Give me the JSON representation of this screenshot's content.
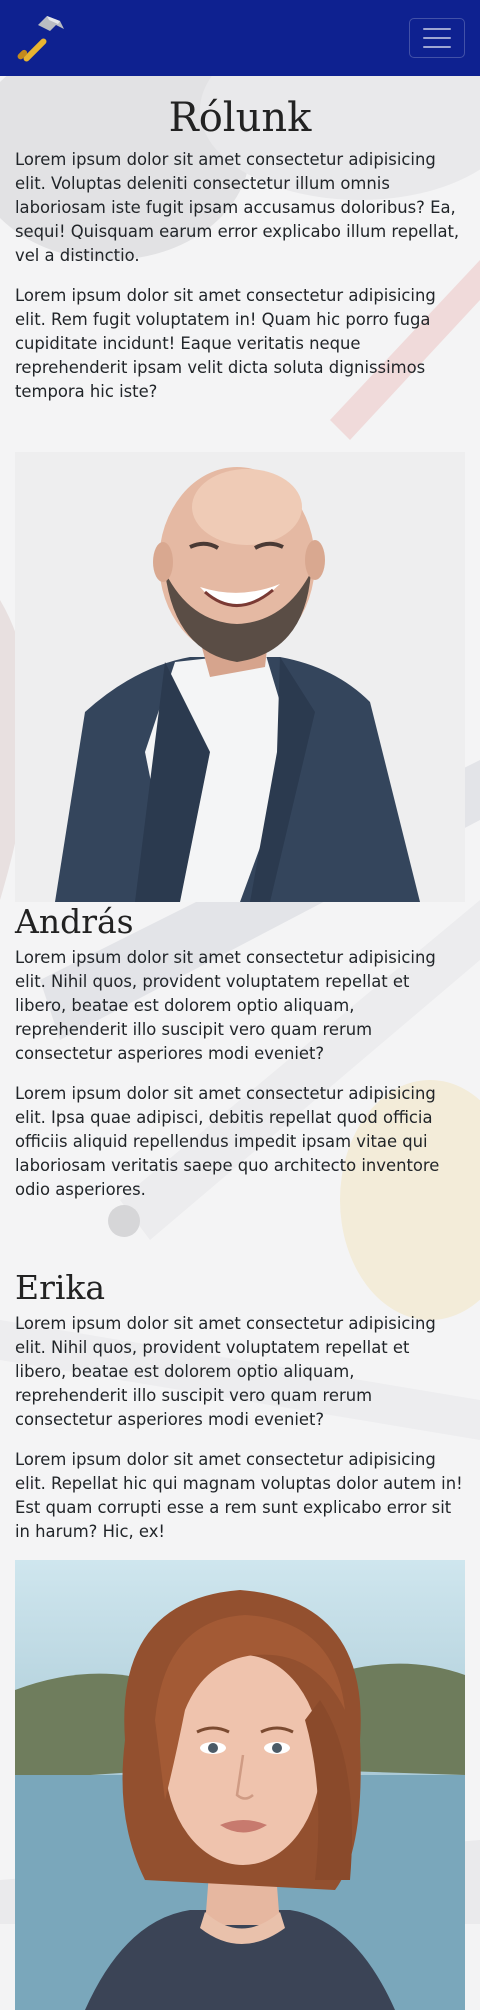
{
  "navbar": {
    "logo_icon": "hammer-icon",
    "toggle_icon": "hamburger-menu-icon",
    "color": "#0e2190"
  },
  "about": {
    "title": "Rólunk",
    "paragraphs": [
      "Lorem ipsum dolor sit amet consectetur adipisicing elit. Voluptas deleniti consectetur illum omnis laboriosam iste fugit ipsam accusamus doloribus? Ea, sequi! Quisquam earum error explicabo illum repellat, vel a distinctio.",
      "Lorem ipsum dolor sit amet consectetur adipisicing elit. Rem fugit voluptatem in! Quam hic porro fuga cupiditate incidunt! Eaque veritatis neque reprehenderit ipsam velit dicta soluta dignissimos tempora hic iste?"
    ]
  },
  "people": [
    {
      "name": "András",
      "photo": "portrait-laughing-bald-man",
      "paragraphs": [
        "Lorem ipsum dolor sit amet consectetur adipisicing elit. Nihil quos, provident voluptatem repellat et libero, beatae est dolorem optio aliquam, reprehenderit illo suscipit vero quam rerum consectetur asperiores modi eveniet?",
        "Lorem ipsum dolor sit amet consectetur adipisicing elit. Ipsa quae adipisci, debitis repellat quod officia officiis aliquid repellendus impedit ipsam vitae qui laboriosam veritatis saepe quo architecto inventore odio asperiores."
      ]
    },
    {
      "name": "Erika",
      "photo": "portrait-red-haired-woman",
      "paragraphs": [
        "Lorem ipsum dolor sit amet consectetur adipisicing elit. Nihil quos, provident voluptatem repellat et libero, beatae est dolorem optio aliquam, reprehenderit illo suscipit vero quam rerum consectetur asperiores modi eveniet?",
        "Lorem ipsum dolor sit amet consectetur adipisicing elit. Repellat hic qui magnam voluptas dolor autem in! Est quam corrupti esse a rem sunt explicabo error sit in harum? Hic, ex!"
      ]
    }
  ]
}
